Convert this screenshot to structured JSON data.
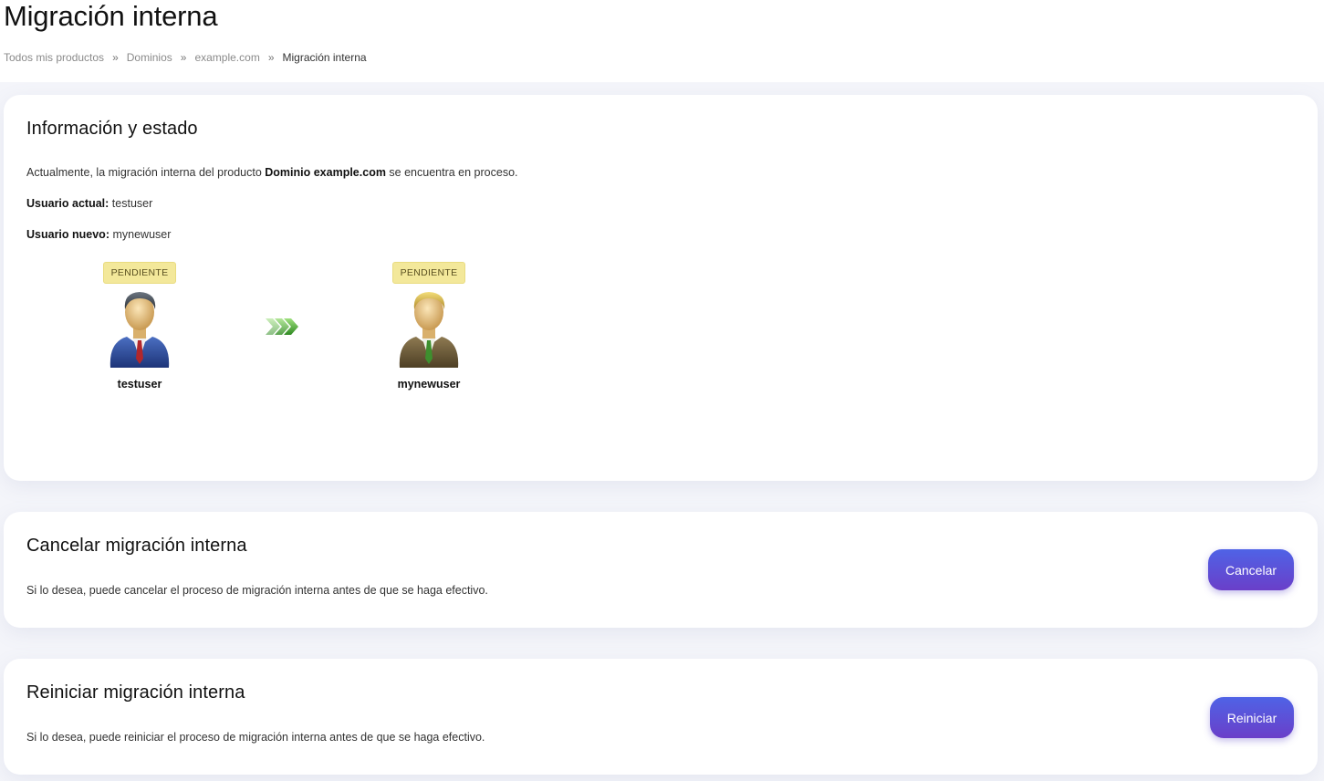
{
  "page": {
    "title": "Migración interna",
    "breadcrumb": [
      "Todos mis productos",
      "Dominios",
      "example.com",
      "Migración interna"
    ],
    "breadcrumb_separator": "»"
  },
  "info": {
    "title": "Información y estado",
    "status_prefix": "Actualmente, la migración interna del producto ",
    "product": "Dominio example.com",
    "status_suffix": " se encuentra en proceso.",
    "current_user_label": "Usuario actual:",
    "current_user": "testuser",
    "new_user_label": "Usuario nuevo:",
    "new_user": "mynewuser",
    "old_badge": "PENDIENTE",
    "new_badge": "PENDIENTE",
    "old_name": "testuser",
    "new_name": "mynewuser"
  },
  "cancel": {
    "title": "Cancelar migración interna",
    "description": "Si lo desea, puede cancelar el proceso de migración interna antes de que se haga efectivo.",
    "button": "Cancelar"
  },
  "restart": {
    "title": "Reiniciar migración interna",
    "description": "Si lo desea, puede reiniciar el proceso de migración interna antes de que se haga efectivo.",
    "button": "Reiniciar"
  },
  "colors": {
    "badge": "#f3e89a",
    "button_start": "#4f63e6",
    "button_end": "#6a3fc9",
    "arrow": "#4fae3a"
  },
  "icons": {
    "old_user": "user-blue-suit-icon",
    "new_user": "user-olive-suit-icon",
    "transfer": "triple-chevron-arrow-icon"
  }
}
